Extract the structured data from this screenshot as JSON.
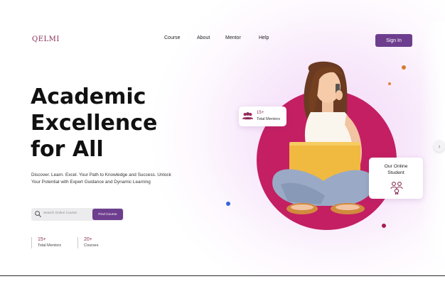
{
  "header": {
    "logo": "QELMI",
    "nav": [
      "Course",
      "About",
      "Mentor",
      "Help"
    ],
    "sign_in_label": "Sign In"
  },
  "hero": {
    "title_lines": [
      "Academic",
      "Excellence",
      "for All"
    ],
    "description": "Discover. Learn. Excel. Your Path to Knowledge and Success. Unlock Your Potential with Expert Guidance and Dynamic Learning"
  },
  "search": {
    "placeholder": "Search Online Course",
    "button_label": "Find Course"
  },
  "stats": [
    {
      "number": "15+",
      "label": "Total Mentors"
    },
    {
      "number": "20+",
      "label": "Courses"
    }
  ],
  "mentors_card": {
    "number": "15+",
    "label": "Total Mentors",
    "icon": "people-icon"
  },
  "student_card": {
    "title_lines": [
      "Our Online",
      "Student"
    ],
    "icon": "student-group-icon"
  },
  "icons": {
    "search": "search-icon",
    "next": "chevron-right-icon"
  },
  "colors": {
    "brand": "#8a2f57",
    "button": "#6e3e8e",
    "accent_circle": "#c41f63"
  }
}
